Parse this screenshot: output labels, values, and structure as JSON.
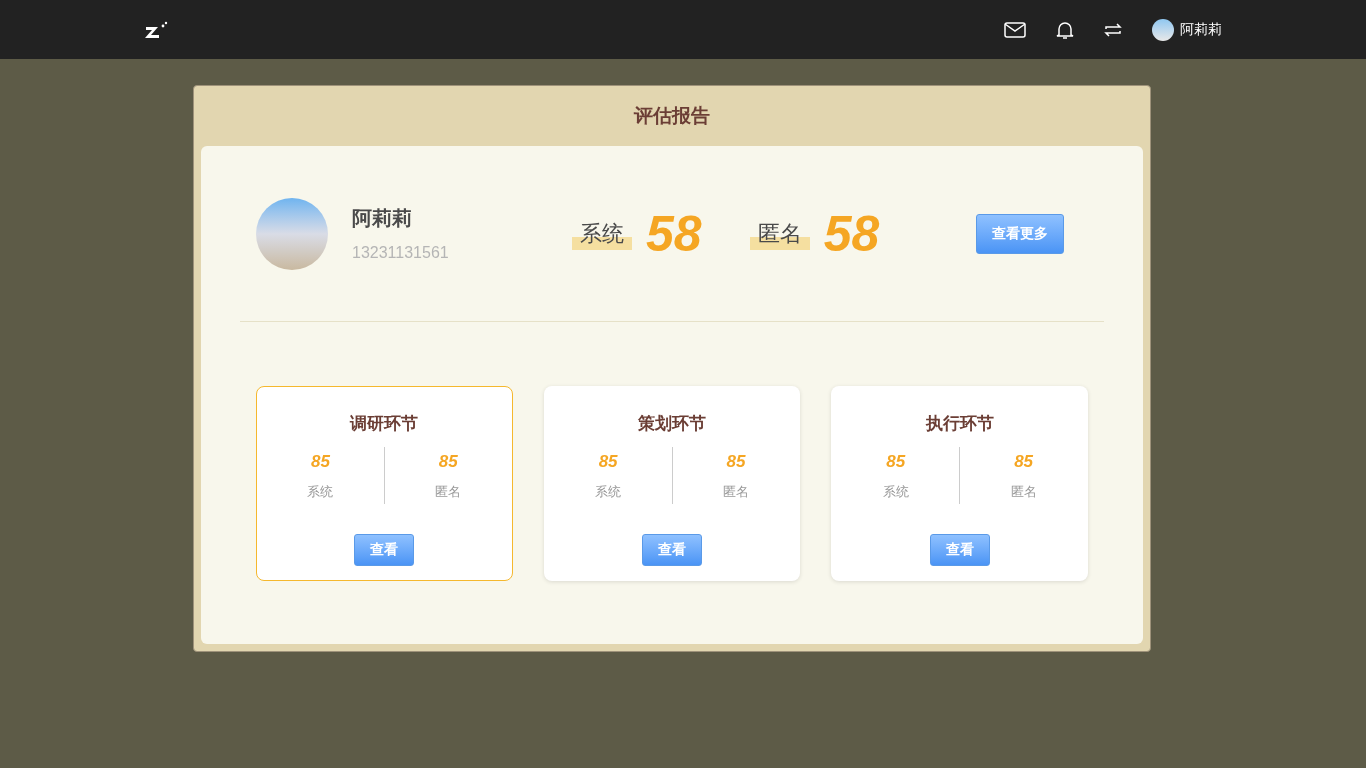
{
  "header": {
    "username": "阿莉莉"
  },
  "report": {
    "title": "评估报告",
    "user": {
      "name": "阿莉莉",
      "phone": "13231131561"
    },
    "scores": [
      {
        "label": "系统",
        "value": "58"
      },
      {
        "label": "匿名",
        "value": "58"
      }
    ],
    "more_button": "查看更多",
    "stages": [
      {
        "title": "调研环节",
        "selected": true,
        "scores": [
          {
            "value": "85",
            "label": "系统"
          },
          {
            "value": "85",
            "label": "匿名"
          }
        ],
        "button": "查看"
      },
      {
        "title": "策划环节",
        "selected": false,
        "scores": [
          {
            "value": "85",
            "label": "系统"
          },
          {
            "value": "85",
            "label": "匿名"
          }
        ],
        "button": "查看"
      },
      {
        "title": "执行环节",
        "selected": false,
        "scores": [
          {
            "value": "85",
            "label": "系统"
          },
          {
            "value": "85",
            "label": "匿名"
          }
        ],
        "button": "查看"
      }
    ]
  }
}
